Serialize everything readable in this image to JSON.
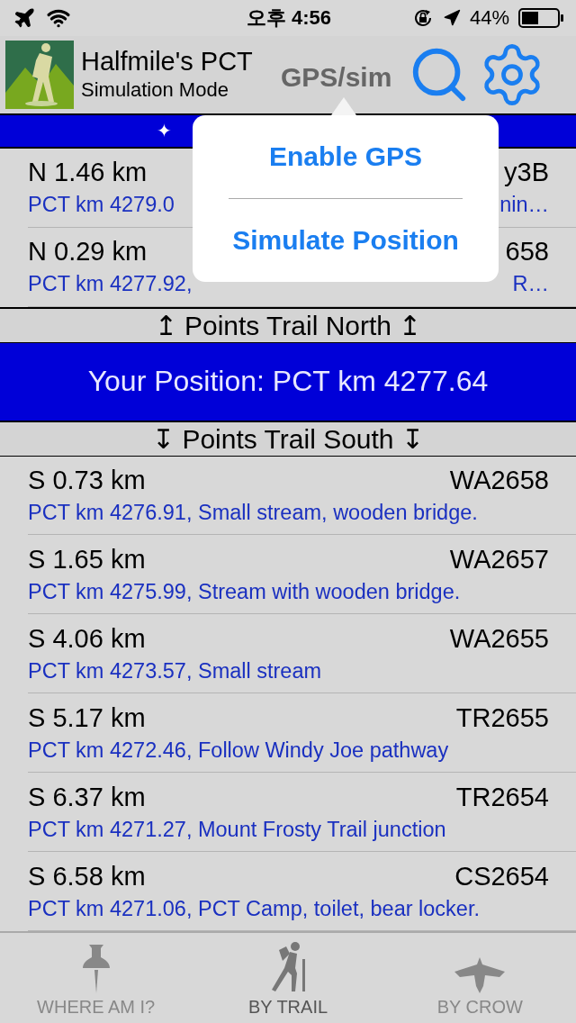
{
  "status_bar": {
    "time": "오후 4:56",
    "battery": "44%"
  },
  "header": {
    "title": "Halfmile's PCT",
    "subtitle": "Simulation Mode",
    "gps_button": "GPS/sim"
  },
  "banner": {
    "symbol": "✦"
  },
  "popover": {
    "items": [
      "Enable GPS",
      "Simulate Position"
    ]
  },
  "north_header": "↥ Points Trail North ↥",
  "north_points": [
    {
      "distance": "N 1.46 km",
      "code": "y3B",
      "description": "PCT km 4279.0",
      "description_end": "nin…"
    },
    {
      "distance": "N 0.29 km",
      "code": "658",
      "description": "PCT km 4277.92,",
      "description_end": "R…"
    }
  ],
  "position": "Your Position: PCT km 4277.64",
  "south_header": "↧ Points Trail South ↧",
  "south_points": [
    {
      "distance": "S 0.73 km",
      "code": "WA2658",
      "description": "PCT km 4276.91, Small stream, wooden bridge."
    },
    {
      "distance": "S 1.65 km",
      "code": "WA2657",
      "description": "PCT km 4275.99, Stream with wooden bridge."
    },
    {
      "distance": "S 4.06 km",
      "code": "WA2655",
      "description": "PCT km 4273.57, Small stream"
    },
    {
      "distance": "S 5.17 km",
      "code": "TR2655",
      "description": "PCT km 4272.46, Follow Windy Joe pathway"
    },
    {
      "distance": "S 6.37 km",
      "code": "TR2654",
      "description": "PCT km 4271.27, Mount Frosty Trail junction"
    },
    {
      "distance": "S 6.58 km",
      "code": "CS2654",
      "description": "PCT km 4271.06, PCT Camp, toilet, bear locker."
    }
  ],
  "tabs": [
    {
      "kind": "pin",
      "label": "WHERE AM I?",
      "selected": false
    },
    {
      "kind": "hiker",
      "label": "BY TRAIL",
      "selected": true
    },
    {
      "kind": "bird",
      "label": "BY CROW",
      "selected": false
    }
  ]
}
